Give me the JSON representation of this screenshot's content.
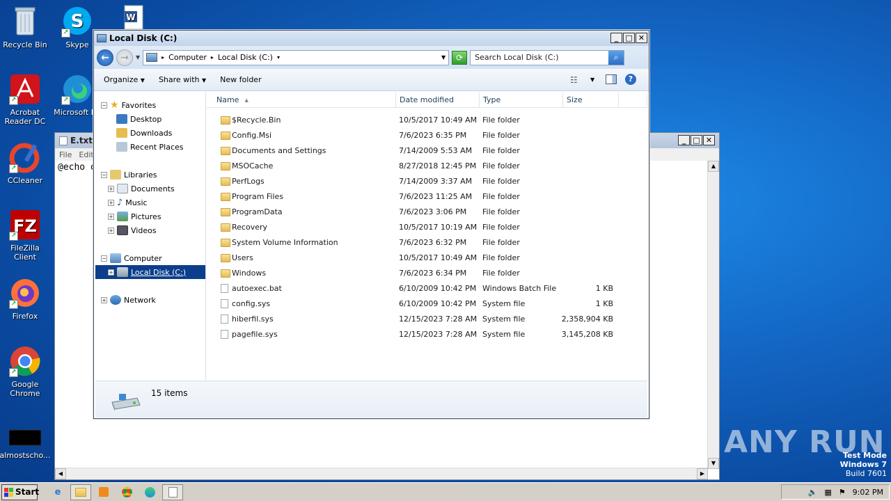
{
  "desktop": {
    "icons": [
      {
        "label": "Recycle Bin",
        "icon": "recycle-bin-icon"
      },
      {
        "label": "Skype",
        "icon": "skype-icon"
      },
      {
        "label": "Acrobat Reader DC",
        "icon": "acrobat-icon"
      },
      {
        "label": "Microsoft Edge",
        "icon": "edge-icon"
      },
      {
        "label": "CCleaner",
        "icon": "ccleaner-icon"
      },
      {
        "label": "FileZilla Client",
        "icon": "filezilla-icon"
      },
      {
        "label": "Firefox",
        "icon": "firefox-icon"
      },
      {
        "label": "Google Chrome",
        "icon": "chrome-icon"
      },
      {
        "label": "almostscho...",
        "icon": "file-icon"
      }
    ],
    "edge_label_visible": "Microsoft Ed"
  },
  "notepad": {
    "title": "E.txt -",
    "menu": [
      "File",
      "Edit"
    ],
    "content": "@echo o"
  },
  "explorer": {
    "title": "Local Disk (C:)",
    "breadcrumb": [
      "Computer",
      "Local Disk (C:)"
    ],
    "search_placeholder": "Search Local Disk (C:)",
    "toolbar": {
      "organize": "Organize",
      "share": "Share with",
      "new_folder": "New folder"
    },
    "nav": {
      "favorites": "Favorites",
      "desktop": "Desktop",
      "downloads": "Downloads",
      "recent": "Recent Places",
      "libraries": "Libraries",
      "documents": "Documents",
      "music": "Music",
      "pictures": "Pictures",
      "videos": "Videos",
      "computer": "Computer",
      "localdisk": "Local Disk (C:)",
      "network": "Network"
    },
    "columns": {
      "name": "Name",
      "date": "Date modified",
      "type": "Type",
      "size": "Size"
    },
    "files": [
      {
        "name": "$Recycle.Bin",
        "date": "10/5/2017 10:49 AM",
        "type": "File folder",
        "size": "",
        "kind": "folder"
      },
      {
        "name": "Config.Msi",
        "date": "7/6/2023 6:35 PM",
        "type": "File folder",
        "size": "",
        "kind": "folder"
      },
      {
        "name": "Documents and Settings",
        "date": "7/14/2009 5:53 AM",
        "type": "File folder",
        "size": "",
        "kind": "link"
      },
      {
        "name": "MSOCache",
        "date": "8/27/2018 12:45 PM",
        "type": "File folder",
        "size": "",
        "kind": "folder"
      },
      {
        "name": "PerfLogs",
        "date": "7/14/2009 3:37 AM",
        "type": "File folder",
        "size": "",
        "kind": "folder"
      },
      {
        "name": "Program Files",
        "date": "7/6/2023 11:25 AM",
        "type": "File folder",
        "size": "",
        "kind": "folder"
      },
      {
        "name": "ProgramData",
        "date": "7/6/2023 3:06 PM",
        "type": "File folder",
        "size": "",
        "kind": "folder"
      },
      {
        "name": "Recovery",
        "date": "10/5/2017 10:19 AM",
        "type": "File folder",
        "size": "",
        "kind": "folder"
      },
      {
        "name": "System Volume Information",
        "date": "7/6/2023 6:32 PM",
        "type": "File folder",
        "size": "",
        "kind": "folder"
      },
      {
        "name": "Users",
        "date": "10/5/2017 10:49 AM",
        "type": "File folder",
        "size": "",
        "kind": "folder"
      },
      {
        "name": "Windows",
        "date": "7/6/2023 6:34 PM",
        "type": "File folder",
        "size": "",
        "kind": "folder"
      },
      {
        "name": "autoexec.bat",
        "date": "6/10/2009 10:42 PM",
        "type": "Windows Batch File",
        "size": "1 KB",
        "kind": "file"
      },
      {
        "name": "config.sys",
        "date": "6/10/2009 10:42 PM",
        "type": "System file",
        "size": "1 KB",
        "kind": "file"
      },
      {
        "name": "hiberfil.sys",
        "date": "12/15/2023 7:28 AM",
        "type": "System file",
        "size": "2,358,904 KB",
        "kind": "file"
      },
      {
        "name": "pagefile.sys",
        "date": "12/15/2023 7:28 AM",
        "type": "System file",
        "size": "3,145,208 KB",
        "kind": "file"
      }
    ],
    "item_count": "15 items"
  },
  "taskbar": {
    "start": "Start",
    "clock": "9:02 PM"
  },
  "watermark": {
    "brand": "ANY RUN",
    "line1": "Test Mode",
    "line2": "Windows 7",
    "line3": "Build 7601"
  },
  "colors": {
    "selection": "#0b3e8c",
    "title_blue": "#c3d5ec"
  }
}
